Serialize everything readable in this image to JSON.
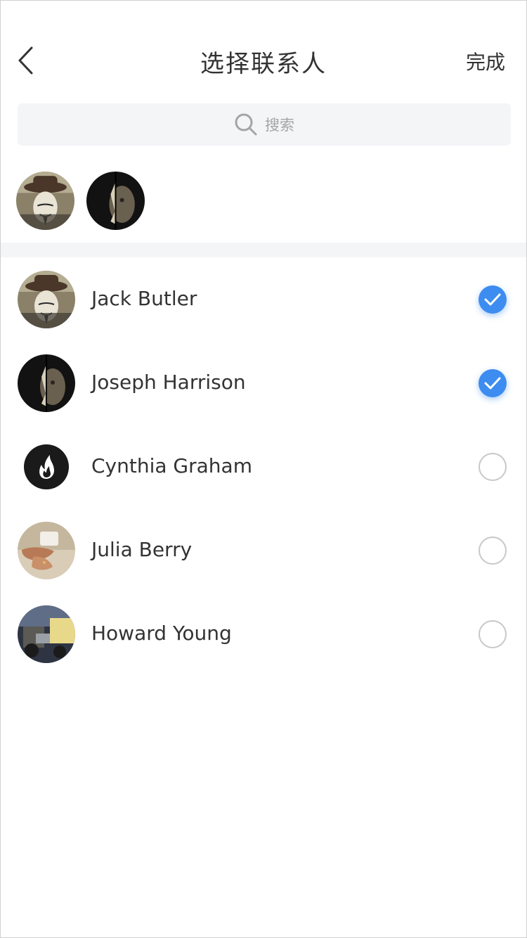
{
  "header": {
    "title": "选择联系人",
    "done_label": "完成",
    "back_icon": "chevron-left-icon"
  },
  "search": {
    "placeholder": "搜索",
    "icon": "search-icon"
  },
  "selected": [
    {
      "name": "Jack Butler"
    },
    {
      "name": "Joseph Harrison"
    }
  ],
  "contacts": [
    {
      "name": "Jack Butler",
      "checked": true
    },
    {
      "name": "Joseph Harrison",
      "checked": true
    },
    {
      "name": "Cynthia Graham",
      "checked": false
    },
    {
      "name": "Julia Berry",
      "checked": false
    },
    {
      "name": "Howard Young",
      "checked": false
    }
  ],
  "colors": {
    "accent": "#3d8cf0",
    "text": "#333333",
    "muted": "#a5a5a5",
    "band": "#f4f5f7"
  }
}
